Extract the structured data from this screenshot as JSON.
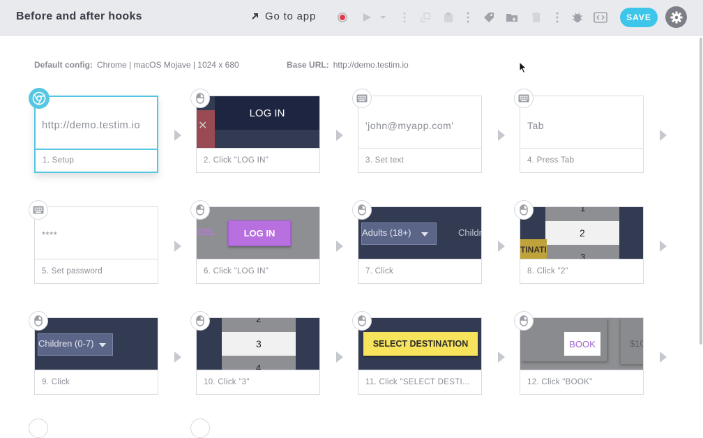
{
  "header": {
    "title": "Before and after hooks",
    "goto_label": "Go to app",
    "save_label": "SAVE"
  },
  "config": {
    "default_label": "Default config:",
    "default_value": "Chrome | macOS Mojave | 1024 x 680",
    "base_label": "Base URL:",
    "base_value": "http://demo.testim.io"
  },
  "steps": [
    {
      "label": "1. Setup",
      "thumb_text": "http://demo.testim.io",
      "icon": "chrome-icon"
    },
    {
      "label": "2. Click \"LOG IN\"",
      "thumb_text": "LOG IN",
      "icon": "mouse-icon"
    },
    {
      "label": "3. Set text",
      "thumb_text": "'john@myapp.com'",
      "icon": "keyboard-icon"
    },
    {
      "label": "4. Press Tab",
      "thumb_text": "Tab",
      "icon": "keyboard-icon"
    },
    {
      "label": "5. Set password",
      "thumb_text": "****",
      "icon": "keyboard-icon"
    },
    {
      "label": "6. Click \"LOG IN\"",
      "thumb_text": "LOG IN",
      "thumb_text_2": "CEL",
      "icon": "mouse-icon"
    },
    {
      "label": "7. Click",
      "thumb_text": "Adults (18+)",
      "thumb_text_2": "Childr",
      "icon": "mouse-icon"
    },
    {
      "label": "8. Click \"2\"",
      "thumb_text": "2",
      "thumb_text_2": "1",
      "thumb_text_3": "3",
      "thumb_text_4": "TINATI",
      "icon": "mouse-icon"
    },
    {
      "label": "9. Click",
      "thumb_text": "Children (0-7)",
      "icon": "mouse-icon"
    },
    {
      "label": "10. Click \"3\"",
      "thumb_text": "3",
      "thumb_text_2": "2",
      "thumb_text_3": "4",
      "icon": "mouse-icon"
    },
    {
      "label": "11. Click \"SELECT DESTI...",
      "thumb_text": "SELECT DESTINATION",
      "icon": "mouse-icon"
    },
    {
      "label": "12. Click \"BOOK\"",
      "thumb_text": "BOOK",
      "thumb_text_2": "$10",
      "icon": "mouse-icon"
    }
  ],
  "colors": {
    "accent": "#3ec6ea",
    "record": "#e0384d",
    "login_purple": "#b86fe0",
    "yellow": "#f8e45c"
  }
}
